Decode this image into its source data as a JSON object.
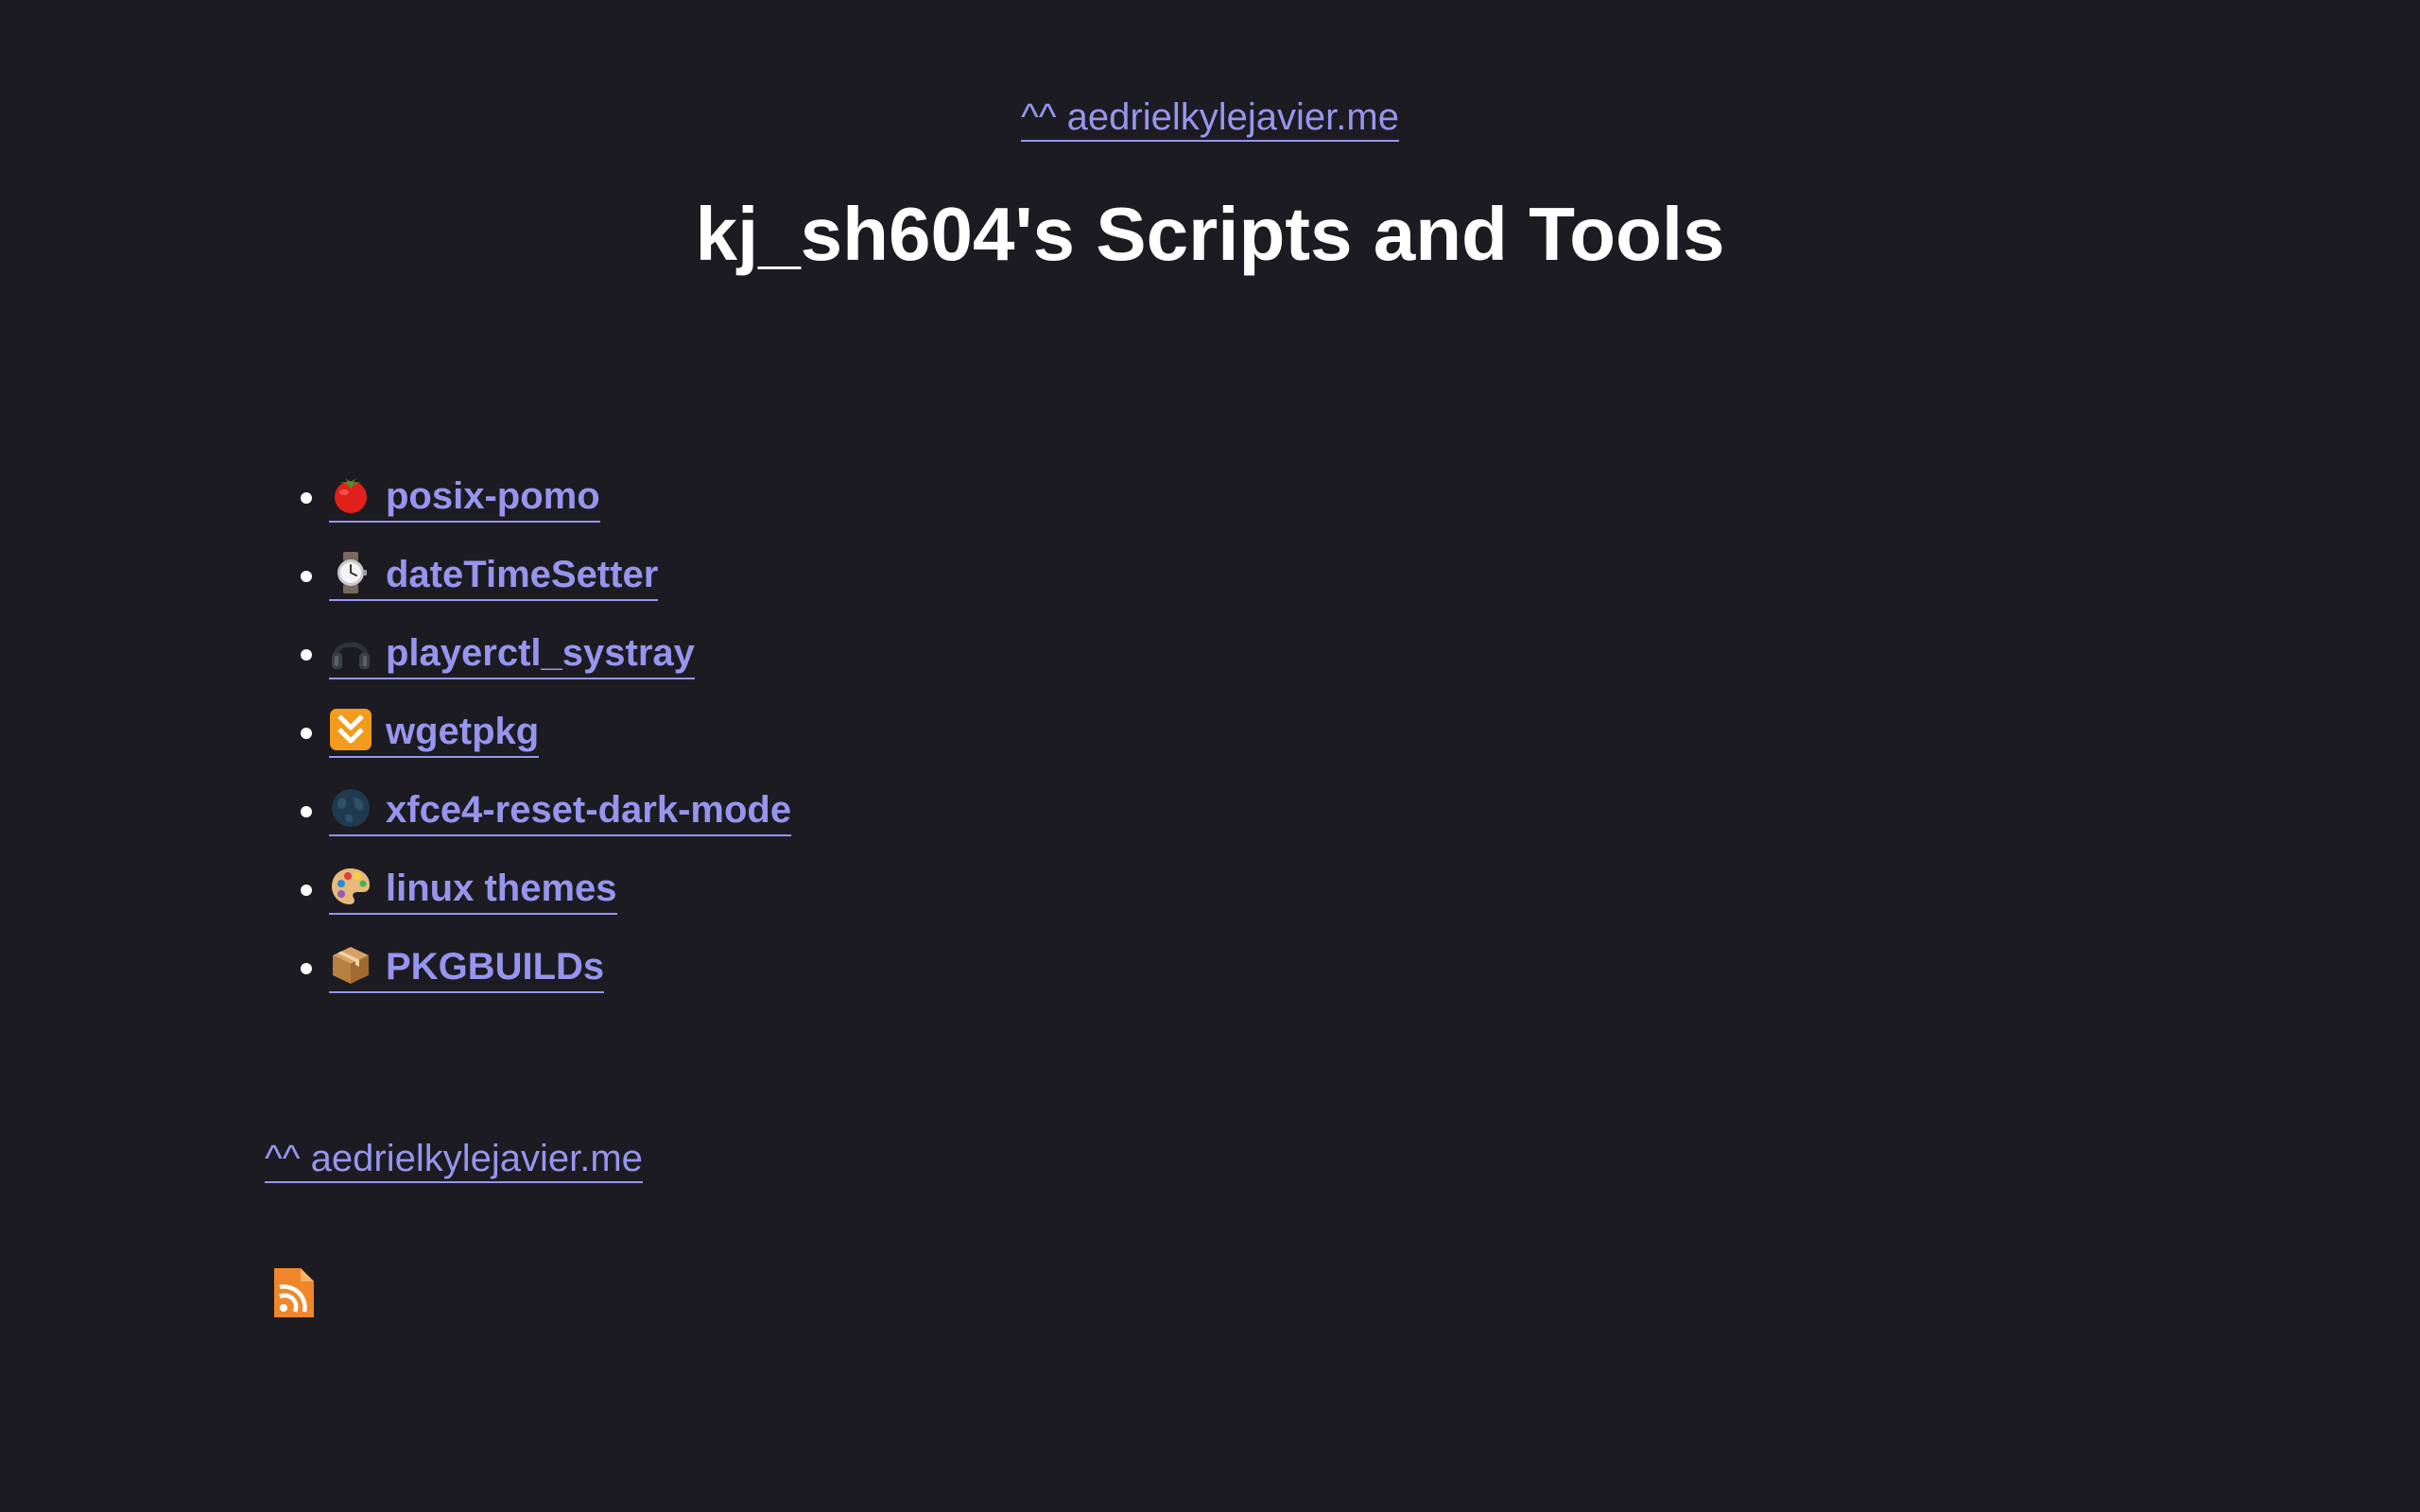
{
  "header": {
    "home_link": "^^ aedrielkylejavier.me"
  },
  "title": "kj_sh604's Scripts and Tools",
  "tools": [
    {
      "label": "posix-pomo",
      "icon": "tomato-icon"
    },
    {
      "label": "dateTimeSetter",
      "icon": "watch-icon"
    },
    {
      "label": "playerctl_systray",
      "icon": "headphones-icon"
    },
    {
      "label": "wgetpkg",
      "icon": "fast-down-icon"
    },
    {
      "label": "xfce4-reset-dark-mode",
      "icon": "globe-icon"
    },
    {
      "label": "linux themes",
      "icon": "palette-icon"
    },
    {
      "label": "PKGBUILDs",
      "icon": "package-icon"
    }
  ],
  "footer": {
    "home_link": "^^ aedrielkylejavier.me",
    "rss_icon": "rss-feed-icon"
  },
  "colors": {
    "background": "#1c1b21",
    "link": "#9695ee",
    "title": "#ffffff",
    "rss": "#f0862a"
  }
}
